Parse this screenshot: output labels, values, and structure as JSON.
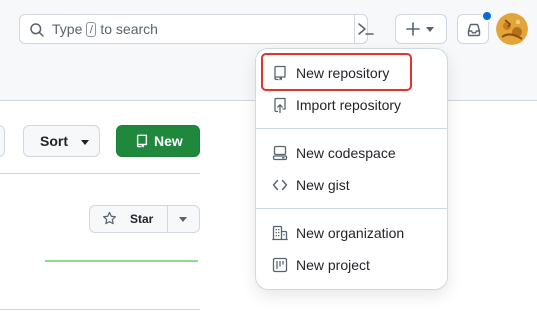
{
  "header": {
    "search": {
      "prefix": "Type",
      "key": "/",
      "suffix": "to search"
    },
    "notification_dot_color": "#0969da"
  },
  "toolbar": {
    "sort_label": "Sort",
    "new_label": "New",
    "new_button_color": "#1f883d"
  },
  "repo_card": {
    "star_label": "Star"
  },
  "create_menu": {
    "items": [
      {
        "label": "New repository",
        "icon": "repo-icon"
      },
      {
        "label": "Import repository",
        "icon": "repo-push-icon"
      },
      {
        "label": "New codespace",
        "icon": "codespaces-icon"
      },
      {
        "label": "New gist",
        "icon": "code-icon"
      },
      {
        "label": "New organization",
        "icon": "organization-icon"
      },
      {
        "label": "New project",
        "icon": "project-icon"
      }
    ],
    "highlighted_item": "New repository",
    "highlight_color": "#e5322d"
  }
}
